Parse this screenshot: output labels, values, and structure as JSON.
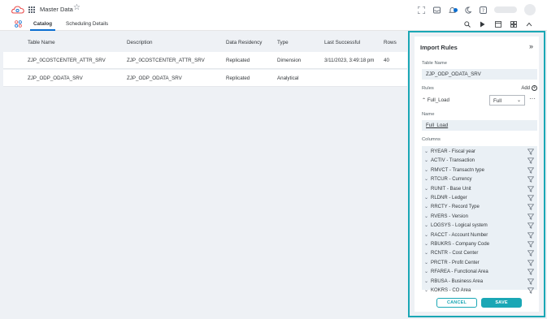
{
  "app": {
    "title": "Master Data"
  },
  "tabs": [
    {
      "label": "Catalog",
      "active": true
    },
    {
      "label": "Scheduling Details",
      "active": false
    }
  ],
  "table": {
    "headers": [
      "Table Name",
      "Description",
      "Data Residency",
      "Type",
      "Last Successful",
      "Rows"
    ],
    "rows": [
      [
        "ZJP_0COSTCENTER_ATTR_SRV",
        "ZJP_0COSTCENTER_ATTR_SRV",
        "Replicated",
        "Dimension",
        "3/11/2023, 3:49:18 pm",
        "40"
      ],
      [
        "ZJP_ODP_ODATA_SRV",
        "ZJP_ODP_ODATA_SRV",
        "Replicated",
        "Analytical",
        "",
        ""
      ]
    ]
  },
  "panel": {
    "title": "Import Rules",
    "table_name_label": "Table Name",
    "table_name_value": "ZJP_ODP_ODATA_SRV",
    "rules_label": "Rules",
    "add_label": "Add",
    "rule_name": "Full_Load",
    "rule_type": "Full",
    "name_label": "Name",
    "name_value": "Full_Load",
    "columns_label": "Columns",
    "columns": [
      "RYEAR - Fiscal year",
      "ACTIV - Transaction",
      "RMVCT - Transactn type",
      "RTCUR - Currency",
      "RUNIT - Base Unit",
      "RLDNR - Ledger",
      "RRCTY - Record Type",
      "RVERS - Version",
      "LOGSYS - Logical system",
      "RACCT - Account Number",
      "RBUKRS - Company Code",
      "RCNTR - Cost Center",
      "PRCTR - Profit Center",
      "RFAREA - Functional Area",
      "RBUSA - Business Area",
      "KOKRS - CO Area"
    ],
    "cancel_label": "CANCEL",
    "save_label": "SAVE"
  },
  "colors": {
    "accent": "#1aa7b5",
    "brand_blue": "#0a6ed1",
    "logo_red": "#e94e4e"
  }
}
